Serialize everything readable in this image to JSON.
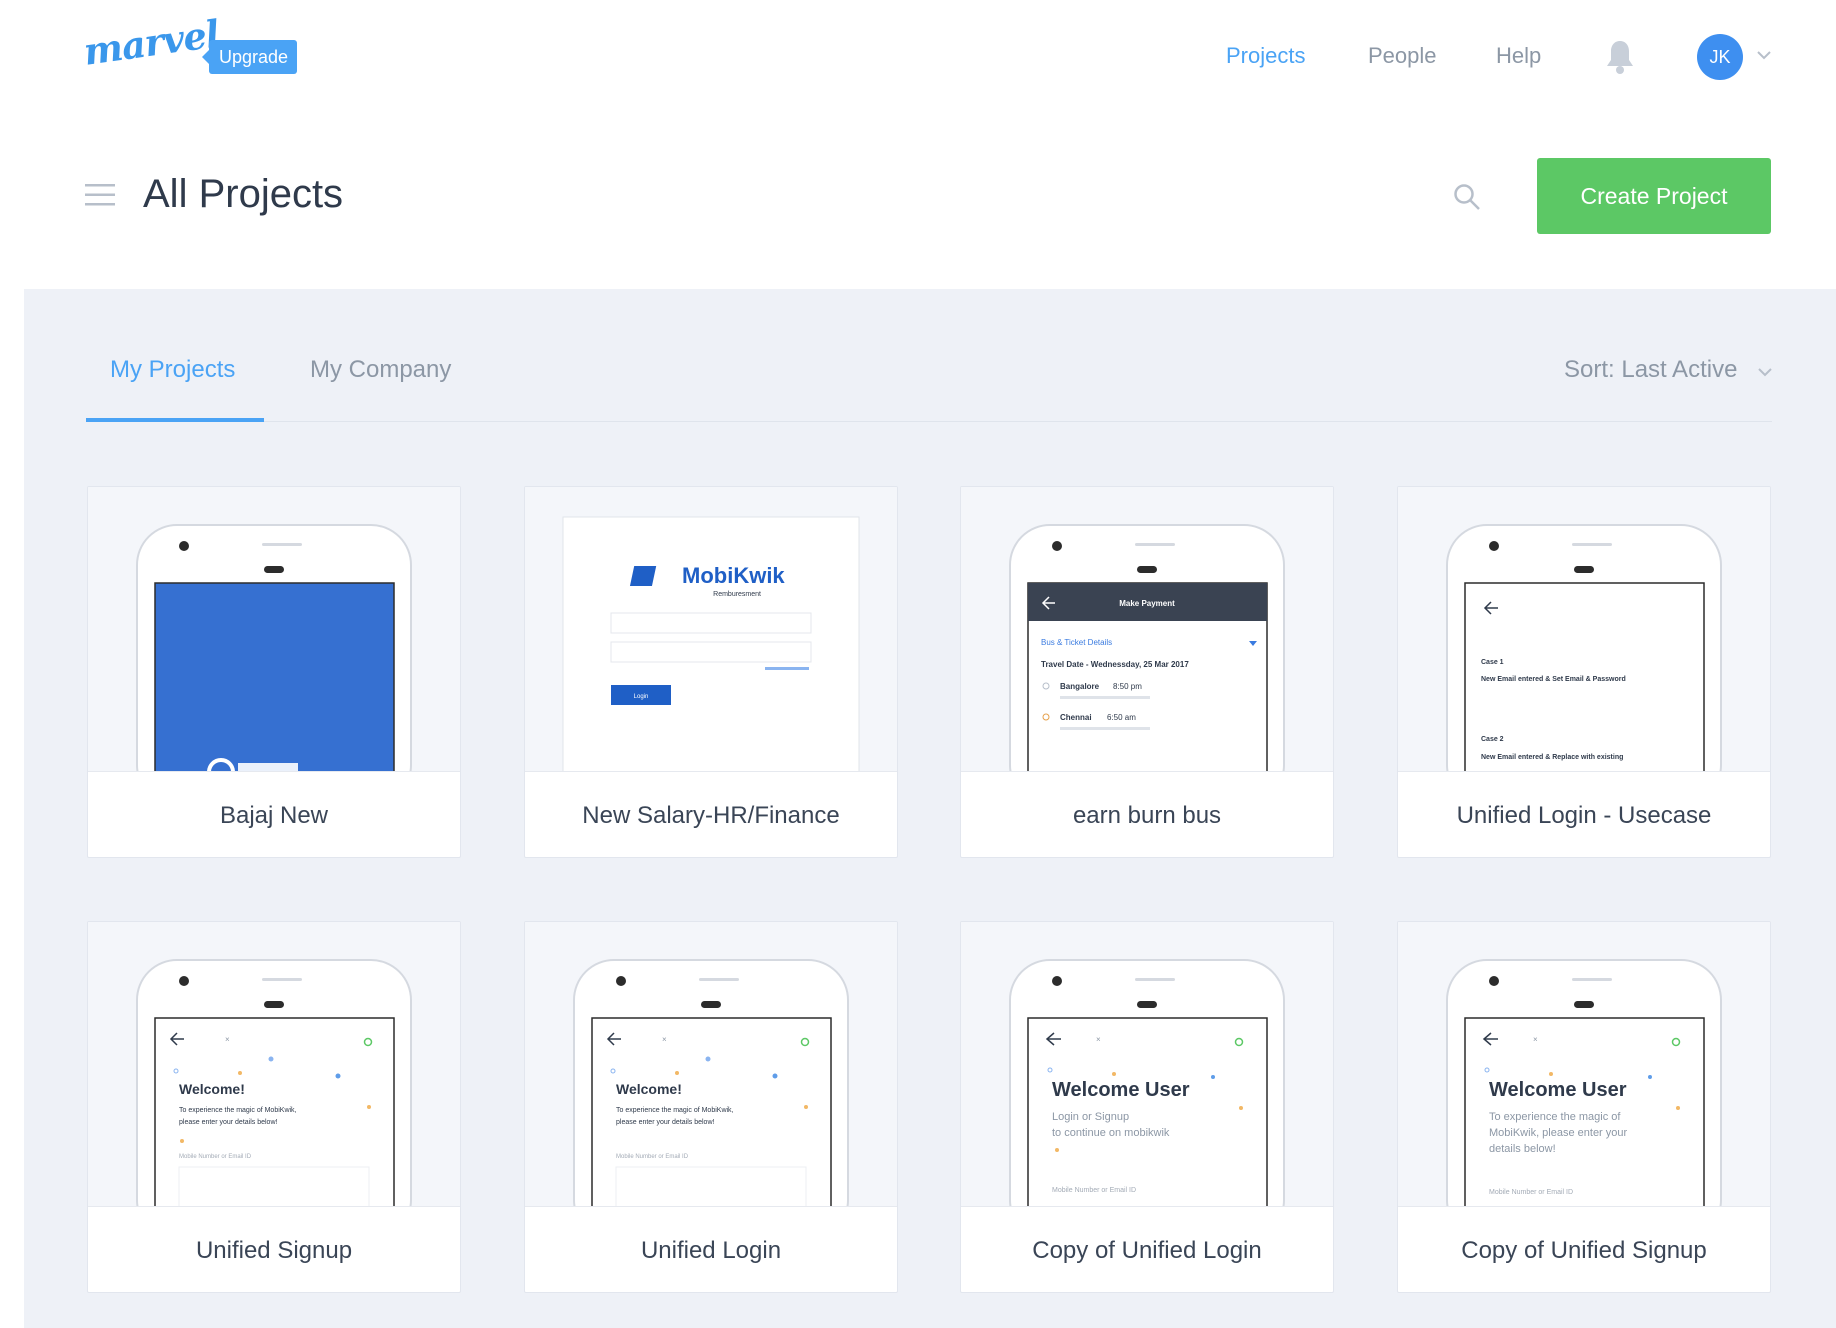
{
  "nav": {
    "logo": "marvel",
    "upgrade": "Upgrade",
    "links": [
      "Projects",
      "People",
      "Help"
    ],
    "avatar_initials": "JK",
    "accent_color": "#4aa3f5"
  },
  "header": {
    "title": "All Projects",
    "create_button": "Create Project",
    "create_color": "#5cc865"
  },
  "tabs": {
    "items": [
      "My Projects",
      "My Company"
    ],
    "active": "My Projects",
    "sort": "Sort: Last Active"
  },
  "projects": [
    {
      "title": "Bajaj New",
      "preview": {
        "type": "blue-screen"
      }
    },
    {
      "title": "New Salary-HR/Finance",
      "preview": {
        "type": "web-login",
        "brand": "MobiKwik",
        "subtitle": "Remburesment",
        "button": "Login"
      }
    },
    {
      "title": "earn burn bus",
      "preview": {
        "type": "make-payment",
        "header": "Make Payment",
        "section": "Bus & Ticket Details",
        "date": "Travel Date - Wednessday, 25 Mar 2017",
        "stop1": "Bangalore",
        "time1": "8:50 pm",
        "stop2": "Chennai",
        "time2": "6:50 am"
      }
    },
    {
      "title": "Unified Login - Usecase",
      "preview": {
        "type": "usecase",
        "case1": "Case 1",
        "case1_text": "New Email entered & Set Email & Password",
        "case2": "Case 2",
        "case2_text": "New Email entered & Replace with existing"
      }
    },
    {
      "title": "Unified Signup",
      "preview": {
        "type": "welcome",
        "heading": "Welcome!",
        "line1": "To experience the magic of MobiKwik,",
        "line2": "please enter your details below!",
        "field": "Mobile Number or Email ID"
      }
    },
    {
      "title": "Unified Login",
      "preview": {
        "type": "welcome",
        "heading": "Welcome!",
        "line1": "To experience the magic of MobiKwik,",
        "line2": "please enter your details below!",
        "field": "Mobile Number or Email ID"
      }
    },
    {
      "title": "Copy of Unified Login",
      "preview": {
        "type": "welcome-user",
        "heading": "Welcome User",
        "line1": "Login or Signup",
        "line2": "to continue on mobikwik",
        "field": "Mobile Number or Email ID"
      }
    },
    {
      "title": "Copy of Unified Signup",
      "preview": {
        "type": "welcome-user",
        "heading": "Welcome User",
        "line1": "To experience the magic of",
        "line2": "MobiKwik, please enter your",
        "line3": "details below!",
        "field": "Mobile Number or Email ID"
      }
    }
  ]
}
